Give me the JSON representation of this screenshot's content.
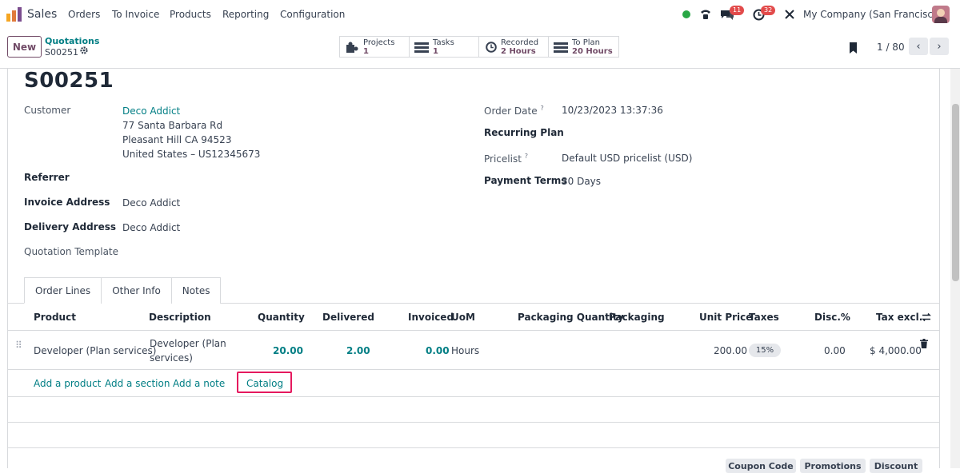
{
  "app": {
    "name": "Sales"
  },
  "menu": [
    "Orders",
    "To Invoice",
    "Products",
    "Reporting",
    "Configuration"
  ],
  "systray": {
    "messages_count": "11",
    "activities_count": "32",
    "company": "My Company (San Francisco)"
  },
  "breadcrumb": {
    "parent": "Quotations",
    "current": "S00251"
  },
  "new_label": "New",
  "smart_buttons": [
    {
      "label": "Projects",
      "value": "1",
      "icon": "puzzle-icon"
    },
    {
      "label": "Tasks",
      "value": "1",
      "icon": "tasks-icon"
    },
    {
      "label": "Recorded",
      "value": "2 Hours",
      "icon": "clock-icon"
    },
    {
      "label": "To Plan",
      "value": "20 Hours",
      "icon": "tasks-icon"
    }
  ],
  "pager": {
    "text": "1 / 80"
  },
  "record": {
    "name": "S00251",
    "customer_label": "Customer",
    "customer_name": "Deco Addict",
    "address_line1": "77 Santa Barbara Rd",
    "address_line2": "Pleasant Hill CA 94523",
    "address_line3": "United States – US12345673",
    "referrer_label": "Referrer",
    "invoice_address_label": "Invoice Address",
    "invoice_address": "Deco Addict",
    "delivery_address_label": "Delivery Address",
    "delivery_address": "Deco Addict",
    "quotation_template_label": "Quotation Template",
    "order_date_label": "Order Date",
    "order_date": "10/23/2023 13:37:36",
    "recurring_plan_label": "Recurring Plan",
    "pricelist_label": "Pricelist",
    "pricelist": "Default USD pricelist (USD)",
    "payment_terms_label": "Payment Terms",
    "payment_terms": "30 Days",
    "help_marker": "?"
  },
  "tabs": [
    "Order Lines",
    "Other Info",
    "Notes"
  ],
  "table": {
    "headers": [
      "Product",
      "Description",
      "Quantity",
      "Delivered",
      "Invoiced",
      "UoM",
      "Packaging Quantity",
      "Packaging",
      "Unit Price",
      "Taxes",
      "Disc.%",
      "Tax excl."
    ],
    "row": {
      "product": "Developer (Plan services)",
      "description_line1": "Developer (Plan",
      "description_line2": "services)",
      "quantity": "20.00",
      "delivered": "2.00",
      "invoiced": "0.00",
      "uom": "Hours",
      "unit_price": "200.00",
      "tax": "15%",
      "discount": "0.00",
      "subtotal": "$ 4,000.00"
    },
    "actions": [
      "Add a product",
      "Add a section",
      "Add a note",
      "Catalog"
    ]
  },
  "bottom_buttons": [
    "Coupon Code",
    "Promotions",
    "Discount"
  ],
  "colors": {
    "brand": "#714b67",
    "link": "#017e84",
    "highlight": "#e5195e"
  }
}
